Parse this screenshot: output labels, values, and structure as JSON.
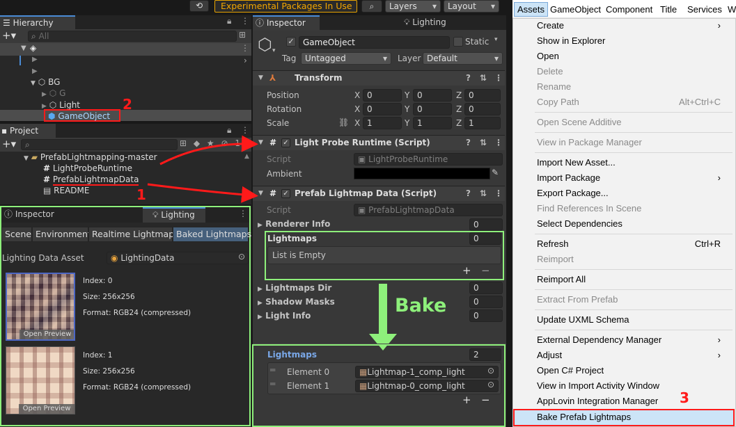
{
  "toolbar": {
    "history_icon": "history-icon",
    "experimental_label": "Experimental Packages In Use",
    "layers_label": "Layers",
    "layout_label": "Layout"
  },
  "hierarchy": {
    "title": "Hierarchy",
    "search_placeholder": "All",
    "items": {
      "bg": "BG",
      "g": "G",
      "light": "Light",
      "gameobject": "GameObject"
    }
  },
  "project": {
    "title": "Project",
    "root": "PrefabLightmapping-master",
    "files": [
      "LightProbeRuntime",
      "PrefabLightmapData",
      "README"
    ]
  },
  "lighting_window": {
    "tab_inspector": "Inspector",
    "tab_lighting": "Lighting",
    "subtabs": [
      "Scene",
      "Environment",
      "Realtime Lightmaps",
      "Baked Lightmaps"
    ],
    "asset_label": "Lighting Data Asset",
    "asset_value": "LightingData",
    "previews": [
      {
        "index": "Index: 0",
        "size": "Size: 256x256",
        "format": "Format: RGB24 (compressed)",
        "button": "Open Preview"
      },
      {
        "index": "Index: 1",
        "size": "Size: 256x256",
        "format": "Format: RGB24 (compressed)",
        "button": "Open Preview"
      }
    ]
  },
  "inspector": {
    "tab_inspector": "Inspector",
    "tab_lighting": "Lighting",
    "object_name": "GameObject",
    "static_label": "Static",
    "tag_label": "Tag",
    "tag_value": "Untagged",
    "layer_label": "Layer",
    "layer_value": "Default",
    "transform": {
      "title": "Transform",
      "rows": [
        {
          "label": "Position",
          "x": "0",
          "y": "0",
          "z": "0"
        },
        {
          "label": "Rotation",
          "x": "0",
          "y": "0",
          "z": "0"
        },
        {
          "label": "Scale",
          "x": "1",
          "y": "1",
          "z": "1"
        }
      ],
      "axis": {
        "x": "X",
        "y": "Y",
        "z": "Z"
      }
    },
    "probe": {
      "title": "Light Probe Runtime (Script)",
      "script_label": "Script",
      "script_value": "LightProbeRuntime",
      "ambient_label": "Ambient"
    },
    "prefab": {
      "title": "Prefab Lightmap Data (Script)",
      "script_label": "Script",
      "script_value": "PrefabLightmapData",
      "renderer_info": "Renderer Info",
      "renderer_count": "0",
      "lightmaps": "Lightmaps",
      "lightmaps_count": "0",
      "list_empty": "List is Empty",
      "lightmaps_dir": "Lightmaps Dir",
      "dir_count": "0",
      "shadow_masks": "Shadow Masks",
      "shadow_count": "0",
      "light_info": "Light Info",
      "light_count": "0"
    },
    "bake_label": "Bake",
    "after": {
      "lightmaps": "Lightmaps",
      "count": "2",
      "elements": [
        {
          "label": "Element 0",
          "value": "Lightmap-1_comp_light"
        },
        {
          "label": "Element 1",
          "value": "Lightmap-0_comp_light"
        }
      ]
    }
  },
  "annotations": {
    "one": "1",
    "two": "2",
    "three": "3"
  },
  "menubar": [
    "Assets",
    "GameObject",
    "Component",
    "Title",
    "Services",
    "Wi"
  ],
  "menu": {
    "create": "Create",
    "show_explorer": "Show in Explorer",
    "open": "Open",
    "delete": "Delete",
    "rename": "Rename",
    "copy_path": "Copy Path",
    "copy_path_shortcut": "Alt+Ctrl+C",
    "open_scene_additive": "Open Scene Additive",
    "view_package_manager": "View in Package Manager",
    "import_new_asset": "Import New Asset...",
    "import_package": "Import Package",
    "export_package": "Export Package...",
    "find_references": "Find References In Scene",
    "select_dependencies": "Select Dependencies",
    "refresh": "Refresh",
    "refresh_shortcut": "Ctrl+R",
    "reimport": "Reimport",
    "reimport_all": "Reimport All",
    "extract_prefab": "Extract From Prefab",
    "update_uxml": "Update UXML Schema",
    "external_dependency": "External Dependency Manager",
    "adjust": "Adjust",
    "open_csharp": "Open C# Project",
    "view_import_activity": "View in Import Activity Window",
    "applovin": "AppLovin Integration Manager",
    "bake_prefab": "Bake Prefab Lightmaps"
  },
  "colors": {
    "accent_red": "#ff1a1a",
    "annotation_green": "#8ef07b",
    "highlight_orange": "#e8a400",
    "selection_blue": "#2c5d87"
  }
}
